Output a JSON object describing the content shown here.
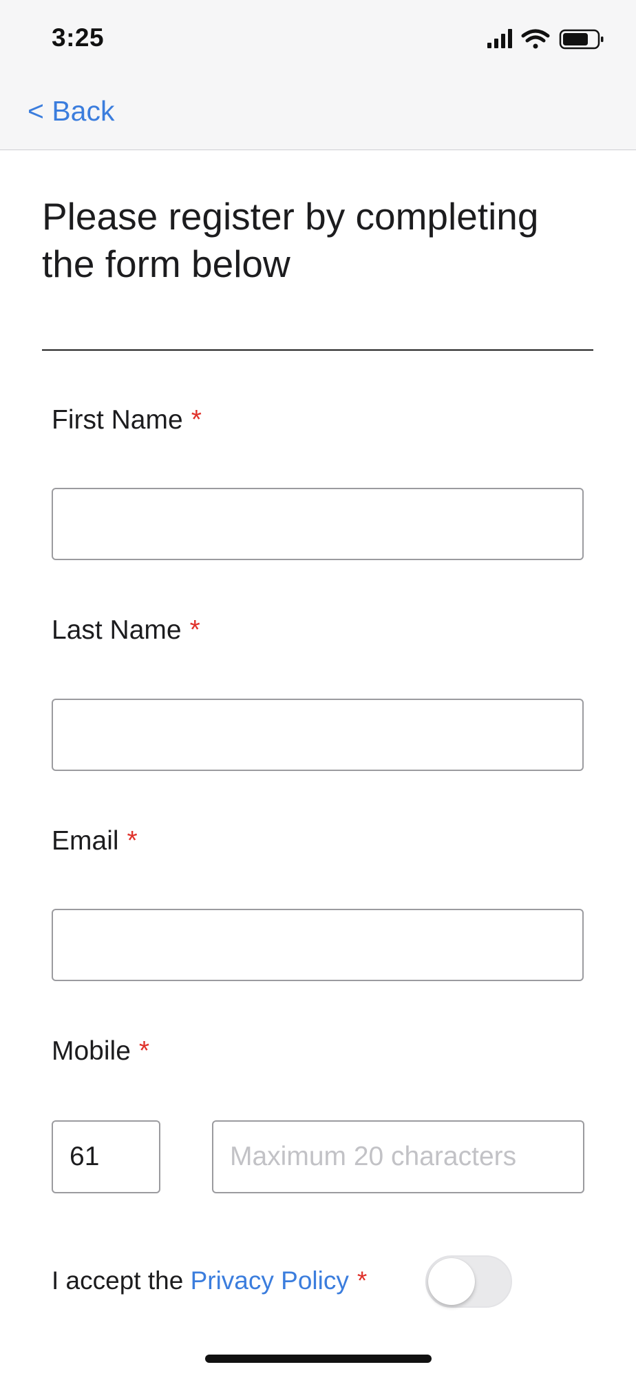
{
  "status_bar": {
    "time": "3:25",
    "icons": [
      "signal-icon",
      "wifi-icon",
      "battery-icon"
    ]
  },
  "nav": {
    "back_label": "< Back"
  },
  "page": {
    "title": "Please register by completing the form below"
  },
  "form": {
    "required_marker": "*",
    "first_name": {
      "label": "First Name",
      "value": ""
    },
    "last_name": {
      "label": "Last Name",
      "value": ""
    },
    "email": {
      "label": "Email",
      "value": ""
    },
    "mobile": {
      "label": "Mobile",
      "country_code": "61",
      "value": "",
      "placeholder": "Maximum 20 characters"
    },
    "privacy": {
      "prefix": "I accept the",
      "link_label": "Privacy Policy",
      "accepted": false
    }
  },
  "colors": {
    "accent": "#3b7ddd",
    "required": "#e0312a",
    "input_border": "#9b9b9f"
  }
}
